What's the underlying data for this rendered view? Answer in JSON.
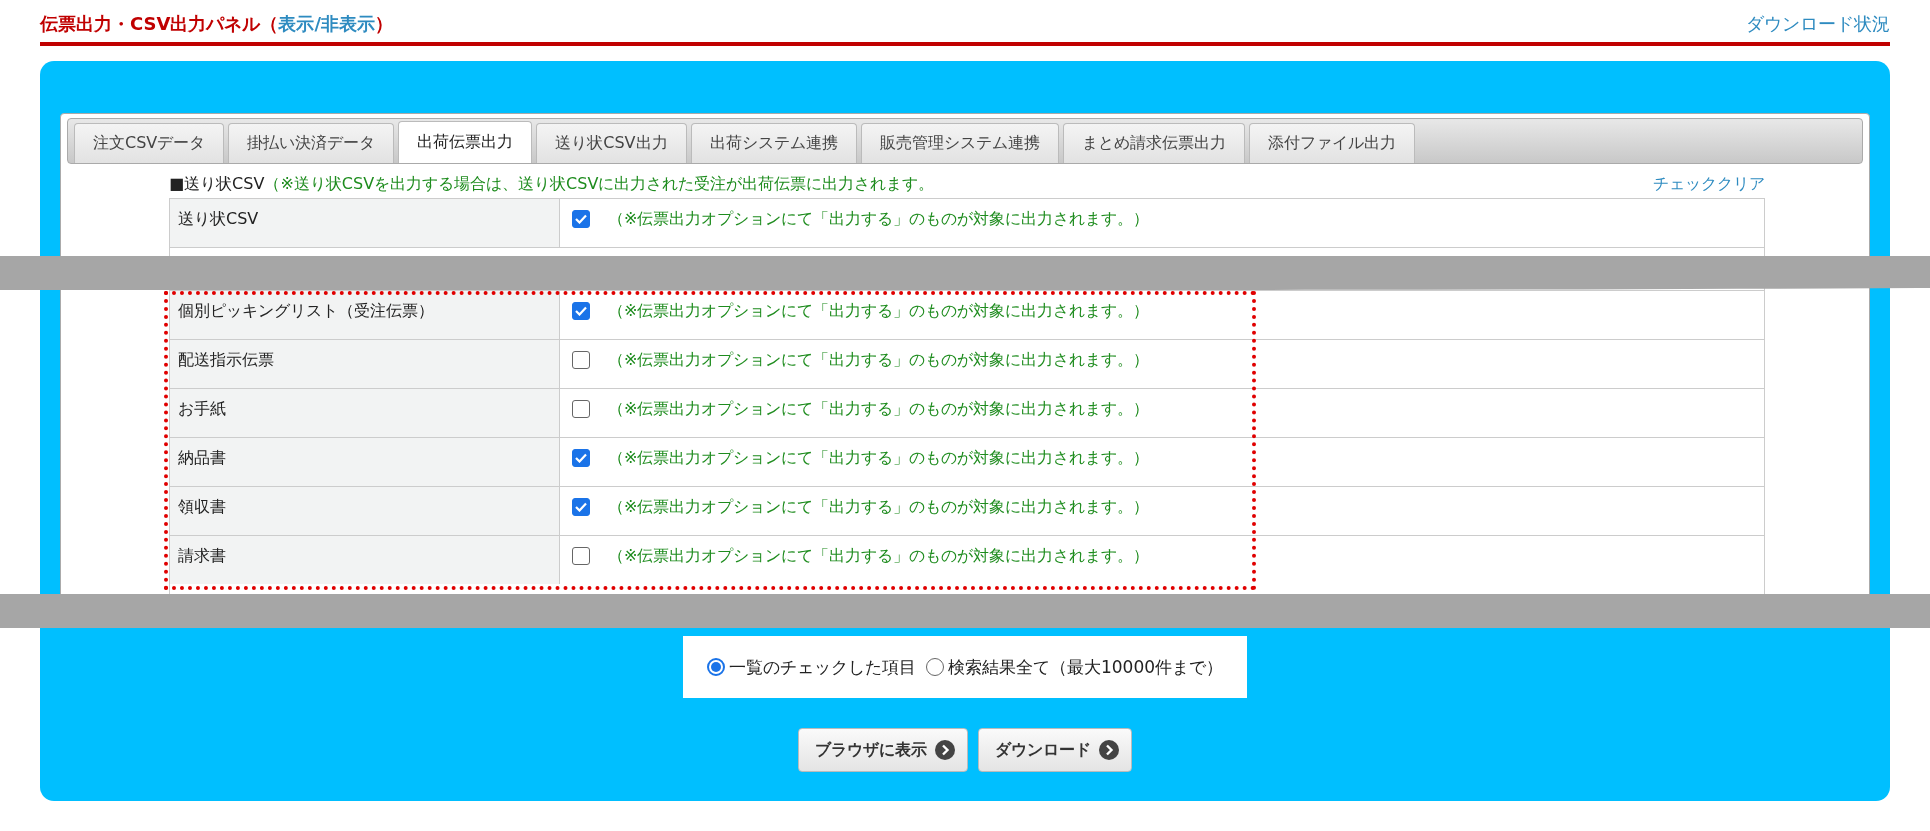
{
  "header": {
    "title": "伝票出力・CSV出力パネル",
    "toggle_link": "表示/非表示",
    "open_paren": "（",
    "close_paren": "）",
    "download_status": "ダウンロード状況"
  },
  "tabs": [
    {
      "label": "注文CSVデータ",
      "selected": false
    },
    {
      "label": "掛払い決済データ",
      "selected": false
    },
    {
      "label": "出荷伝票出力",
      "selected": true
    },
    {
      "label": "送り状CSV出力",
      "selected": false
    },
    {
      "label": "出荷システム連携",
      "selected": false
    },
    {
      "label": "販売管理システム連携",
      "selected": false
    },
    {
      "label": "まとめ請求伝票出力",
      "selected": false
    },
    {
      "label": "添付ファイル出力",
      "selected": false
    }
  ],
  "section": {
    "title": "■送り状CSV",
    "note": "（※送り状CSVを出力する場合は、送り状CSVに出力された受注が出荷伝票に出力されます。",
    "clear_link": "チェッククリア"
  },
  "top_rows": [
    {
      "label": "送り状CSV",
      "checked": true,
      "note": "（※伝票出力オプションにて「出力する」のものが対象に出力されます。）"
    }
  ],
  "highlighted_rows": [
    {
      "label": "個別ピッキングリスト（受注伝票）",
      "checked": true,
      "note": "（※伝票出力オプションにて「出力する」のものが対象に出力されます。）"
    },
    {
      "label": "配送指示伝票",
      "checked": false,
      "note": "（※伝票出力オプションにて「出力する」のものが対象に出力されます。）"
    },
    {
      "label": "お手紙",
      "checked": false,
      "note": "（※伝票出力オプションにて「出力する」のものが対象に出力されます。）"
    },
    {
      "label": "納品書",
      "checked": true,
      "note": "（※伝票出力オプションにて「出力する」のものが対象に出力されます。）"
    },
    {
      "label": "領収書",
      "checked": true,
      "note": "（※伝票出力オプションにて「出力する」のものが対象に出力されます。）"
    },
    {
      "label": "請求書",
      "checked": false,
      "note": "（※伝票出力オプションにて「出力する」のものが対象に出力されます。）"
    }
  ],
  "scope": [
    {
      "label": "一覧のチェックした項目",
      "selected": true
    },
    {
      "label": "検索結果全て（最大10000件まで）",
      "selected": false
    }
  ],
  "buttons": [
    "ブラウザに表示",
    "ダウンロード"
  ]
}
